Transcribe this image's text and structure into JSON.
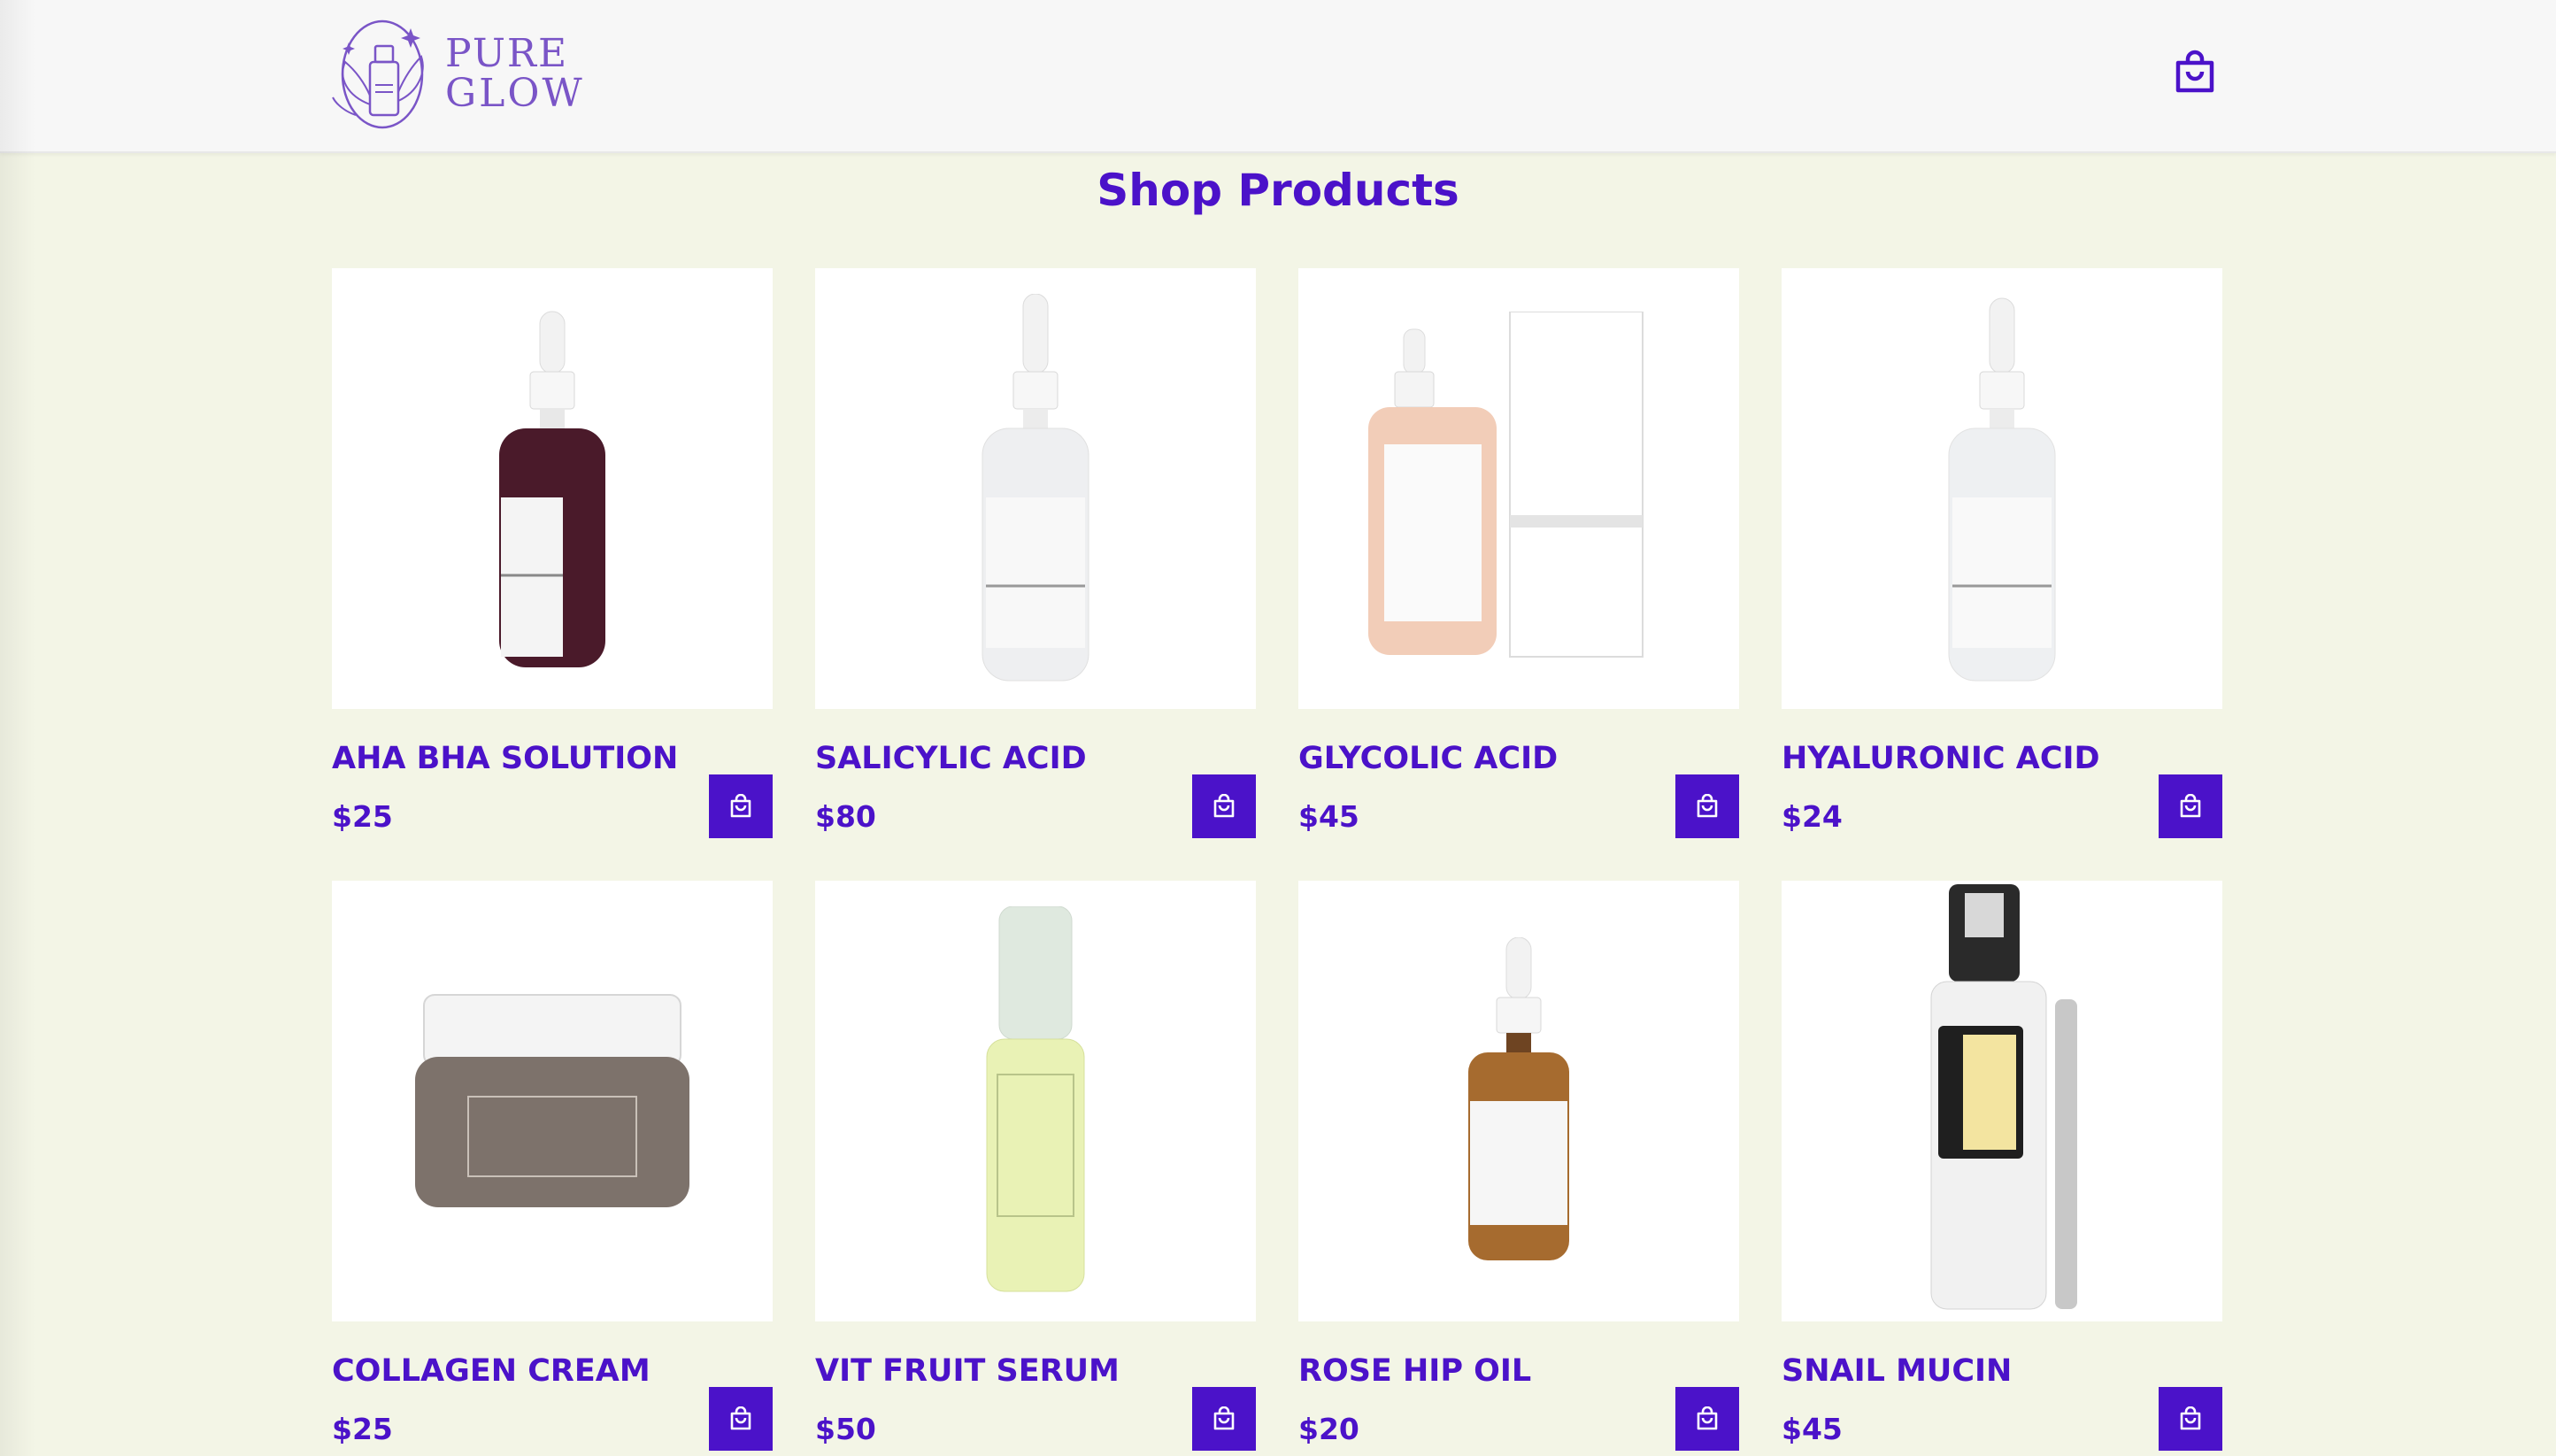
{
  "brand": {
    "line1": "PURE",
    "line2": "GLOW",
    "color": "#7a55c7"
  },
  "header": {
    "cart_icon": "shopping-bag-icon"
  },
  "page_title": "Shop Products",
  "accent_color": "#4b12c9",
  "products": [
    {
      "name": "AHA BHA SOLUTION",
      "price": "$25"
    },
    {
      "name": "SALICYLIC ACID",
      "price": "$80"
    },
    {
      "name": "GLYCOLIC ACID",
      "price": "$45"
    },
    {
      "name": "HYALURONIC ACID",
      "price": "$24"
    },
    {
      "name": "COLLAGEN CREAM",
      "price": "$25"
    },
    {
      "name": "VIT FRUIT SERUM",
      "price": "$50"
    },
    {
      "name": "ROSE HIP OIL",
      "price": "$20"
    },
    {
      "name": "SNAIL MUCIN",
      "price": "$45"
    }
  ]
}
